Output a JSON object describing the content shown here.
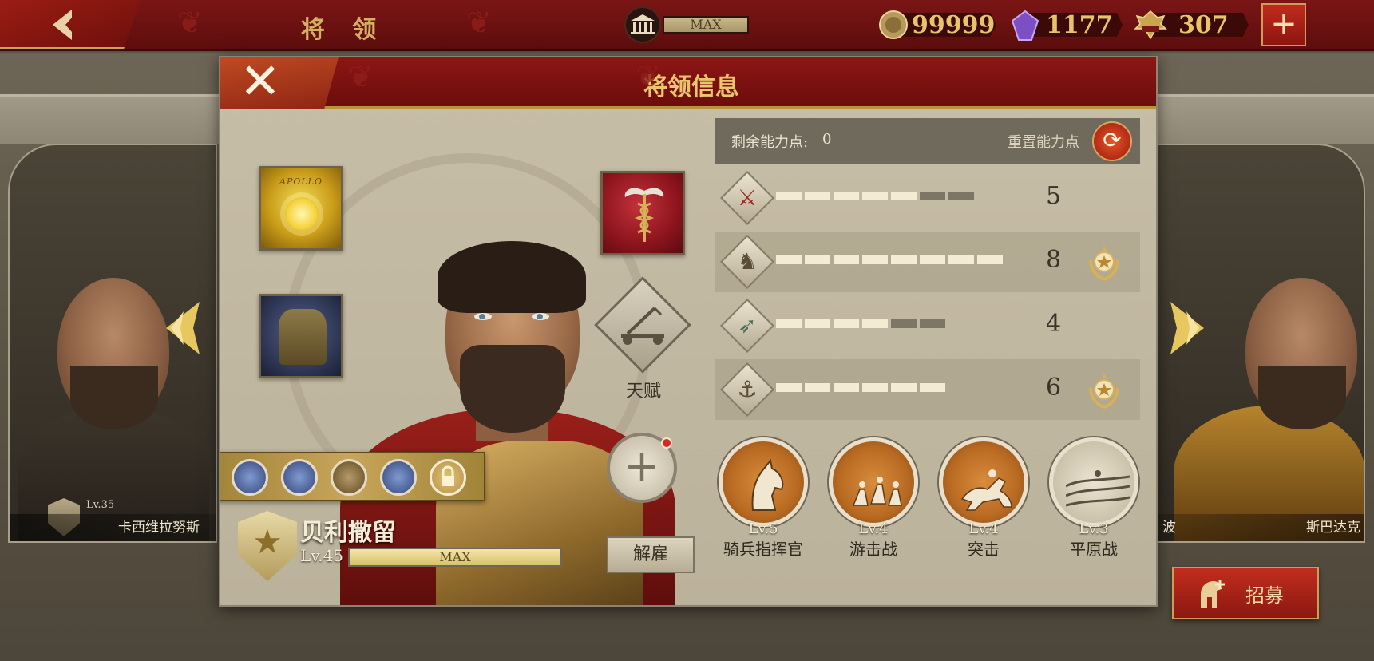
{
  "topbar": {
    "title": "将 领",
    "temple_max": "MAX",
    "resources": [
      {
        "name": "coin",
        "value": "99999"
      },
      {
        "name": "gem",
        "value": "1177"
      },
      {
        "name": "spqr",
        "value": "307"
      }
    ]
  },
  "side_generals": {
    "left": {
      "name": "卡西维拉努斯",
      "level": "Lv.35"
    },
    "right": {
      "name_partial_left": "波",
      "name_partial_right": "斯巴达克"
    }
  },
  "modal": {
    "title": "将领信息",
    "equipment": [
      {
        "name": "apollo-banner",
        "label": "APOLLO"
      },
      {
        "name": "armor"
      },
      {
        "name": "caduceus-banner"
      }
    ],
    "talent_label": "天赋",
    "general": {
      "name": "贝利撒留",
      "level": "Lv.45",
      "level_status": "MAX",
      "level_progress": 1.0,
      "dismiss_label": "解雇"
    },
    "stats_header": {
      "remaining_label": "剩余能力点:",
      "remaining_value": "0",
      "reset_label": "重置能力点"
    },
    "stats": [
      {
        "name": "infantry",
        "icon": "sword-icon",
        "value": "5",
        "filled": 5,
        "total": 7,
        "badge": false
      },
      {
        "name": "cavalry",
        "icon": "horse-icon",
        "value": "8",
        "filled": 8,
        "total": 8,
        "badge": true
      },
      {
        "name": "archery",
        "icon": "bow-icon",
        "value": "4",
        "filled": 4,
        "total": 6,
        "badge": false
      },
      {
        "name": "naval",
        "icon": "anchor-icon",
        "value": "6",
        "filled": 6,
        "total": 6,
        "badge": true
      }
    ],
    "skills": [
      {
        "name": "骑兵指挥官",
        "level": "Lv.5"
      },
      {
        "name": "游击战",
        "level": "Lv.4"
      },
      {
        "name": "突击",
        "level": "Lv.4"
      },
      {
        "name": "平原战",
        "level": "Lv.3"
      }
    ]
  },
  "recruit_label": "招募",
  "colors": {
    "accent_red": "#8d1614",
    "gold": "#e9c56e",
    "parchment": "#c7bea8"
  }
}
